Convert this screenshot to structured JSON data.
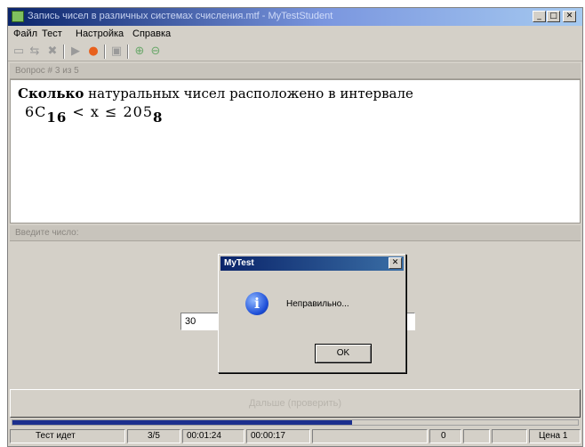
{
  "window": {
    "title": "Запись чисел в различных системах счисления.mtf - MyTestStudent",
    "min_glyph": "_",
    "max_glyph": "□",
    "close_glyph": "✕"
  },
  "menu": [
    "Файл",
    "Тест",
    "Настройка",
    "Справка"
  ],
  "toolbar": {
    "icons": [
      "open-icon",
      "back-icon",
      "stop-icon",
      "play-icon",
      "record-icon",
      "save-icon",
      "zoom-in-icon",
      "zoom-out-icon"
    ]
  },
  "question": {
    "header": "Вопрос # 3 из 5",
    "text_bold": "Сколько",
    "text_rest": " натуральных чисел расположено в интервале",
    "formula_left": "6C",
    "formula_left_base": "16",
    "formula_mid": " < x ≤ 205",
    "formula_right_base": "8"
  },
  "answer": {
    "header": "Введите число:",
    "value": "30"
  },
  "next_button": "Дальше (проверить)",
  "progress": {
    "fraction": 0.6
  },
  "status": {
    "state": "Тест идет",
    "count": "3/5",
    "elapsed": "00:01:24",
    "question_time": "00:00:17",
    "extra": "",
    "score": "0",
    "price": "Цена 1"
  },
  "dialog": {
    "title": "MyTest",
    "message": "Неправильно...",
    "ok_label": "OK",
    "close_glyph": "✕"
  },
  "colors": {
    "titlebar": "#0a246a",
    "progress": "#1c2f8e",
    "window_bg": "#d4d0c8"
  }
}
